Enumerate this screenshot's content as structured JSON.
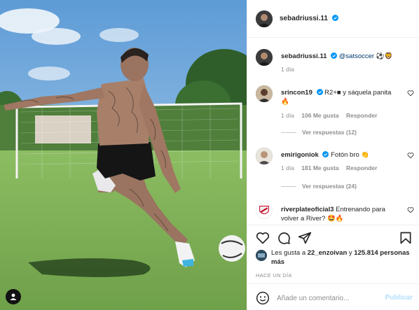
{
  "post": {
    "author": "sebadriussi.11",
    "verified": true,
    "caption_mention": "@satsoccer",
    "caption_emojis": "⚽🦁",
    "caption_time": "1 día"
  },
  "comments": [
    {
      "user": "srincon19",
      "verified": true,
      "text": "R2+■ y sáquela panita 🔥",
      "time": "1 día",
      "likes": "106 Me gusta",
      "reply_label": "Responder",
      "view_replies": "Ver respuestas (12)"
    },
    {
      "user": "emirigoniok",
      "verified": true,
      "text": "Fotón bro 👏",
      "time": "1 día",
      "likes": "181 Me gusta",
      "reply_label": "Responder",
      "view_replies": "Ver respuestas (24)"
    },
    {
      "user": "riverplateoficial3",
      "verified": false,
      "text": "Entrenando para volver a River? 🤩🔥",
      "time": "",
      "likes": "",
      "reply_label": "",
      "view_replies": ""
    }
  ],
  "likes_summary": {
    "prefix": "Les gusta a",
    "user": "22_enzoivan",
    "middle": "y",
    "count": "125.814 personas más"
  },
  "time_ago": "HACE UN DÍA",
  "composer": {
    "placeholder": "Añade un comentario...",
    "post_label": "Publicar"
  },
  "icons": [
    "heart-icon",
    "comment-icon",
    "share-icon",
    "bookmark-icon",
    "emoji-icon",
    "user-tag-icon"
  ],
  "colors": {
    "verified": "#0095f6",
    "post_disabled": "#b2dffc",
    "mention": "#00376b",
    "muted": "#8e8e8e"
  }
}
